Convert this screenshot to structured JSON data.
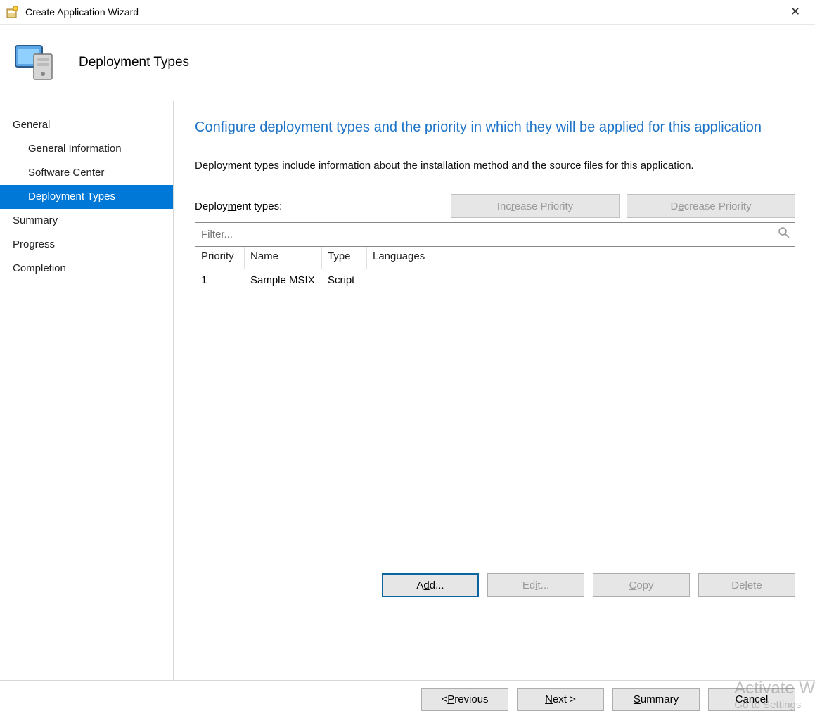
{
  "window": {
    "title": "Create Application Wizard"
  },
  "header": {
    "title": "Deployment Types"
  },
  "sidebar": {
    "items": [
      {
        "label": "General",
        "child": false,
        "selected": false
      },
      {
        "label": "General Information",
        "child": true,
        "selected": false
      },
      {
        "label": "Software Center",
        "child": true,
        "selected": false
      },
      {
        "label": "Deployment Types",
        "child": true,
        "selected": true
      },
      {
        "label": "Summary",
        "child": false,
        "selected": false
      },
      {
        "label": "Progress",
        "child": false,
        "selected": false
      },
      {
        "label": "Completion",
        "child": false,
        "selected": false
      }
    ]
  },
  "main": {
    "heading": "Configure deployment types and the priority in which they will be applied for this application",
    "description": "Deployment types include information about the installation method and the source files for this application.",
    "list_label_pre": "Deploy",
    "list_label_hot": "m",
    "list_label_post": "ent types:",
    "increase_pre": "Inc",
    "increase_hot": "r",
    "increase_post": "ease Priority",
    "decrease_pre": "D",
    "decrease_hot": "e",
    "decrease_post": "crease Priority",
    "filter_placeholder": "Filter...",
    "columns": {
      "priority": "Priority",
      "name": "Name",
      "type": "Type",
      "languages": "Languages"
    },
    "rows": [
      {
        "priority": "1",
        "name": "Sample MSIX",
        "type": "Script",
        "languages": ""
      }
    ],
    "buttons": {
      "add_pre": "A",
      "add_hot": "d",
      "add_post": "d...",
      "edit_pre": "Ed",
      "edit_hot": "i",
      "edit_post": "t...",
      "copy_pre": "",
      "copy_hot": "C",
      "copy_post": "opy",
      "delete_pre": "De",
      "delete_hot": "l",
      "delete_post": "ete"
    }
  },
  "footer": {
    "previous_pre": "< ",
    "previous_hot": "P",
    "previous_post": "revious",
    "next_pre": "",
    "next_hot": "N",
    "next_post": "ext >",
    "summary_pre": "",
    "summary_hot": "S",
    "summary_post": "ummary",
    "cancel": "Cancel"
  },
  "watermark": {
    "line1": "Activate W",
    "line2": "Go to Settings"
  }
}
